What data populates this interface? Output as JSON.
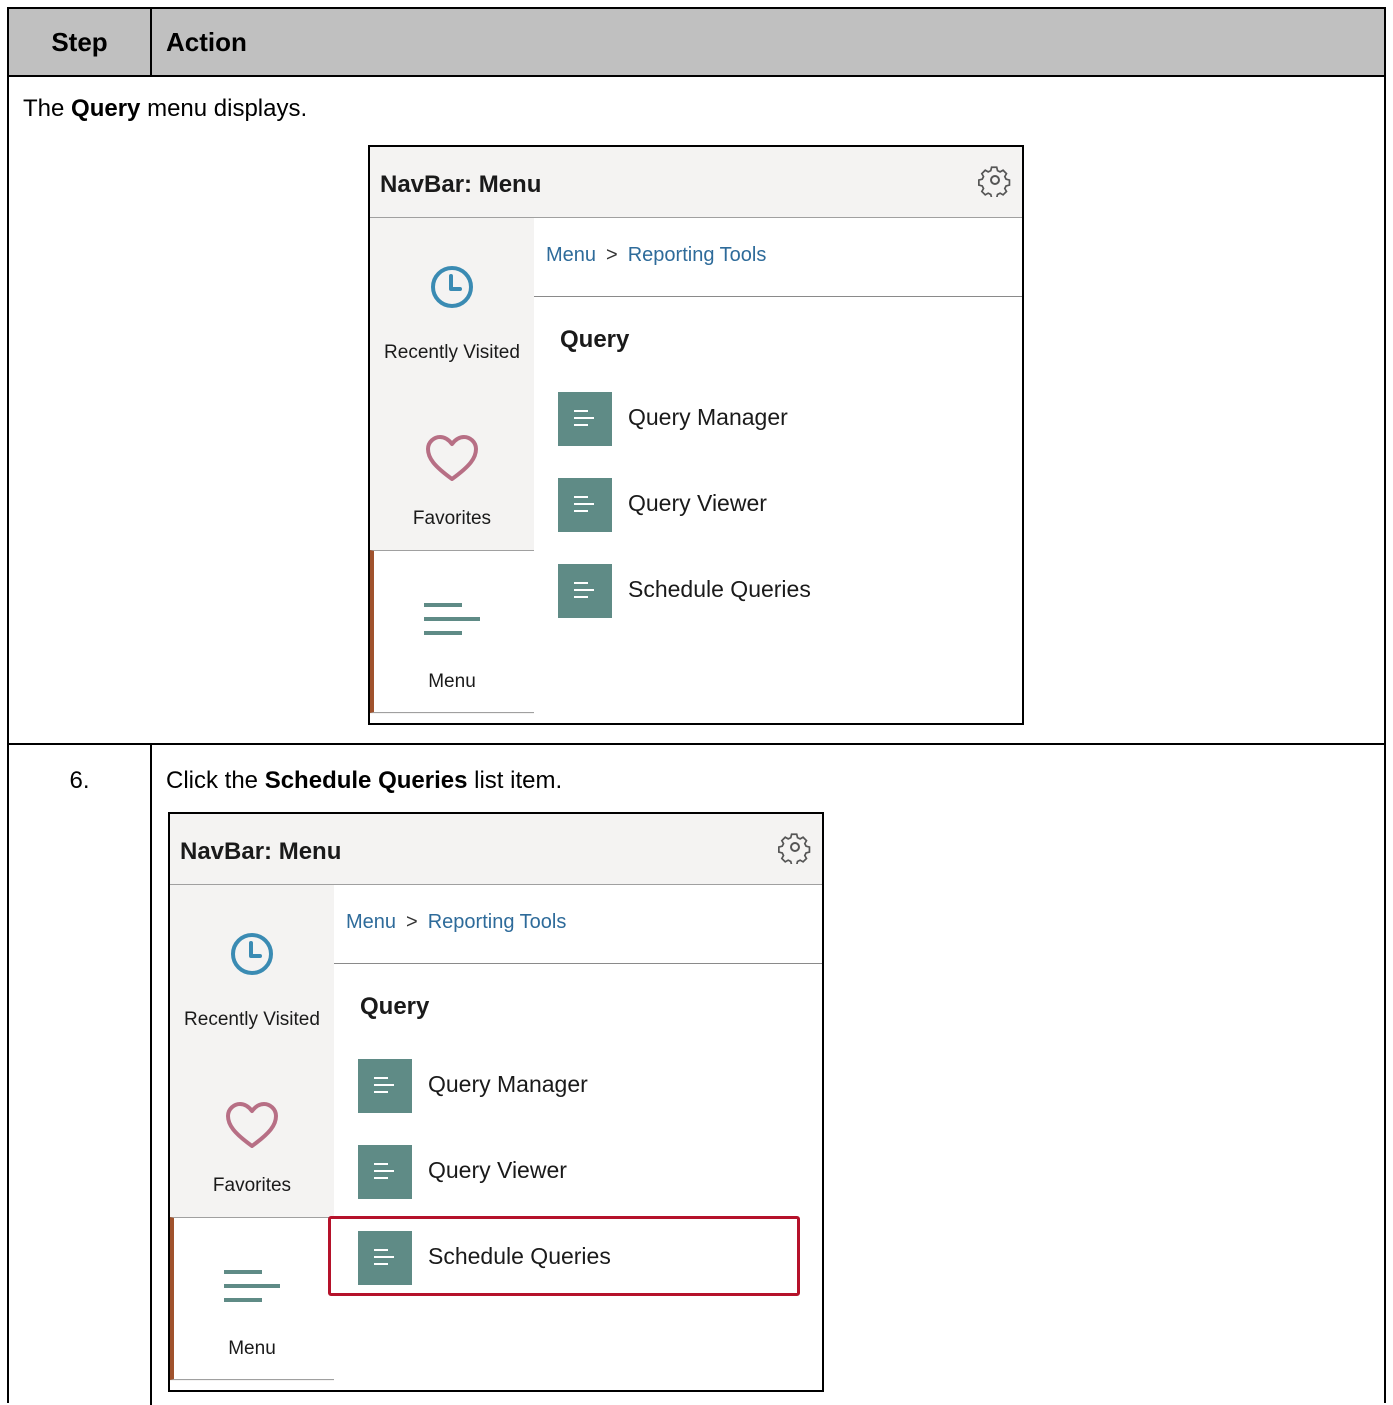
{
  "table": {
    "header": {
      "step": "Step",
      "action": "Action"
    },
    "row1": {
      "text_prefix": "The ",
      "text_bold": "Query",
      "text_suffix": " menu displays."
    },
    "row2": {
      "step": "6.",
      "text_prefix": "Click the ",
      "text_bold": "Schedule Queries",
      "text_suffix": " list item."
    }
  },
  "navbar": {
    "title": "NavBar: Menu",
    "tabs": [
      {
        "label": "Recently Visited",
        "icon": "clock-icon",
        "color": "#3a8bb3"
      },
      {
        "label": "Favorites",
        "icon": "heart-icon",
        "color": "#b76f85"
      },
      {
        "label": "Menu",
        "icon": "menu-lines-icon",
        "color": "#5f8b86",
        "active": true
      }
    ],
    "breadcrumb": {
      "root": "Menu",
      "separator": ">",
      "current": "Reporting Tools"
    },
    "section_title": "Query",
    "items": [
      {
        "label": "Query Manager",
        "icon": "document-lines-icon"
      },
      {
        "label": "Query Viewer",
        "icon": "document-lines-icon"
      },
      {
        "label": "Schedule Queries",
        "icon": "document-lines-icon"
      }
    ],
    "highlight_color": "#b5122a",
    "icon_tile_color": "#5f8b86",
    "active_tab_accent": "#a0522d"
  }
}
